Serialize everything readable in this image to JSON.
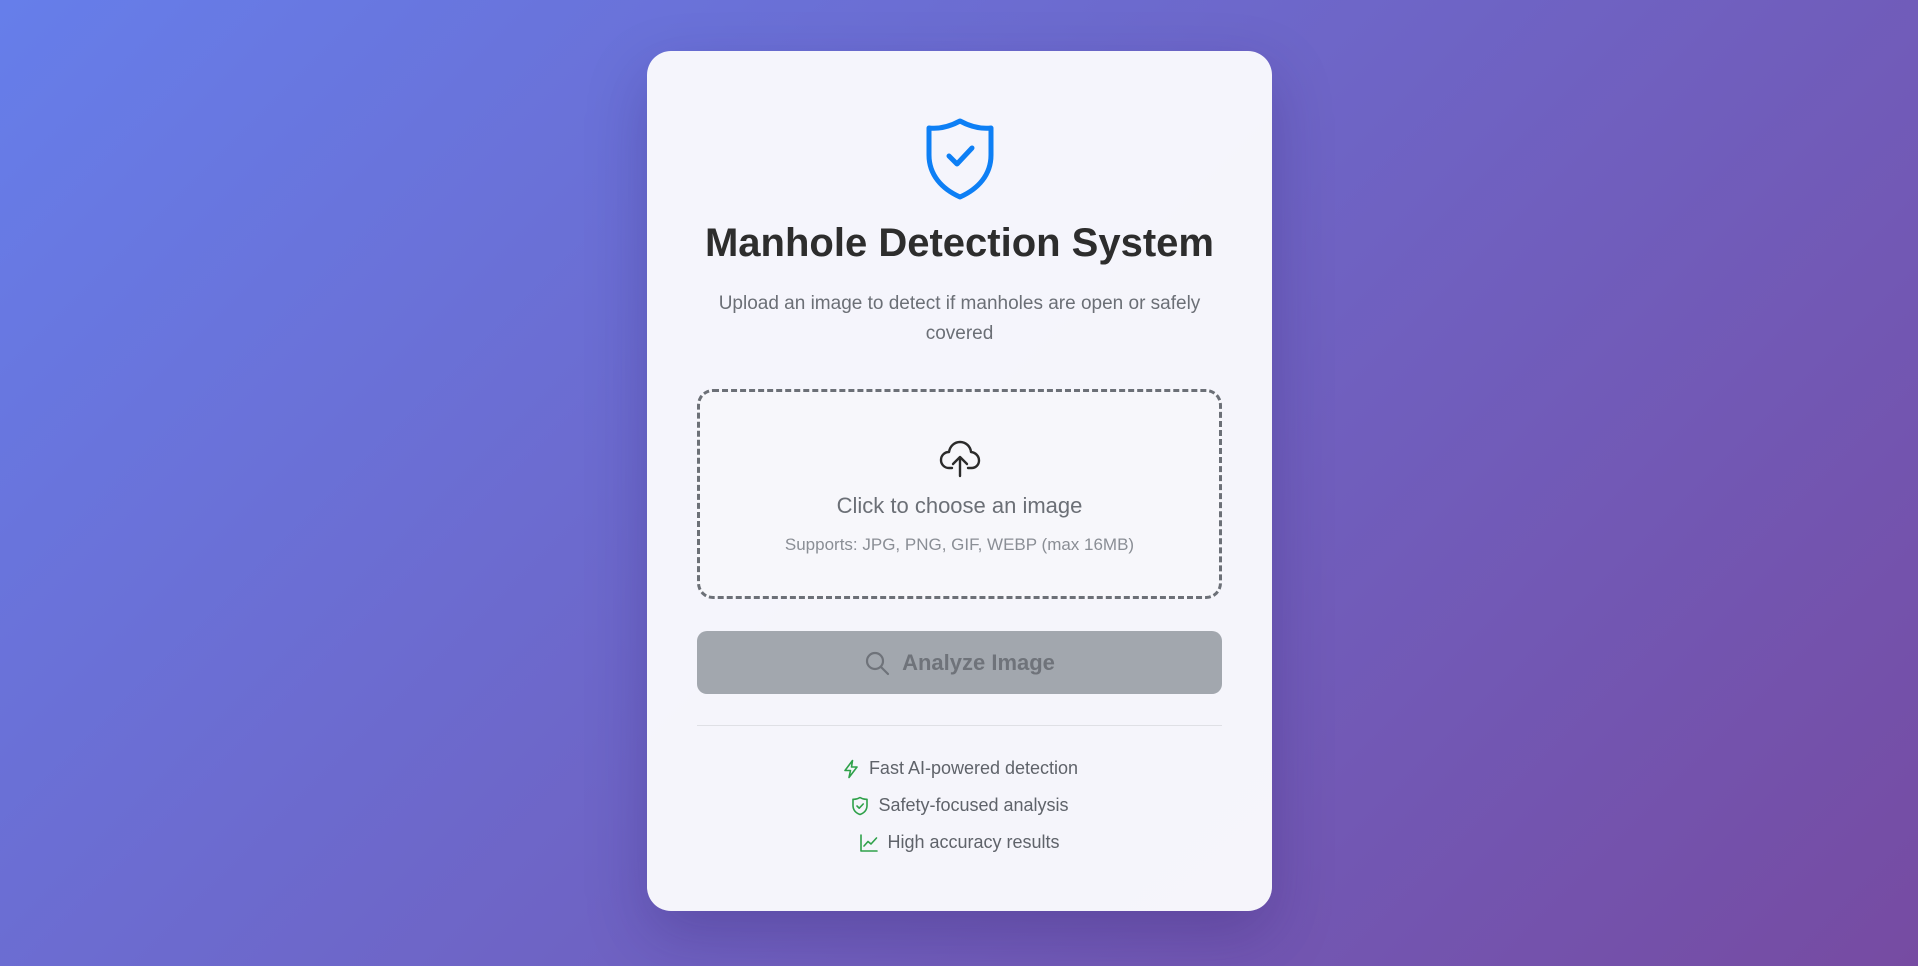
{
  "header": {
    "logo_icon": "shield-check-icon",
    "title": "Manhole Detection System",
    "subtitle": "Upload an image to detect if manholes are open or safely covered"
  },
  "upload": {
    "icon": "cloud-upload-icon",
    "label": "Click to choose an image",
    "hint": "Supports: JPG, PNG, GIF, WEBP (max 16MB)"
  },
  "analyze_button": {
    "icon": "search-icon",
    "label": "Analyze Image",
    "enabled": false
  },
  "features": [
    {
      "icon": "lightning-icon",
      "label": "Fast AI-powered detection"
    },
    {
      "icon": "shield-check-icon",
      "label": "Safety-focused analysis"
    },
    {
      "icon": "line-chart-icon",
      "label": "High accuracy results"
    }
  ],
  "colors": {
    "background_start": "#667eea",
    "background_end": "#764ba2",
    "accent_blue": "#0d7ff5",
    "feature_green": "#2fa14a",
    "button_disabled": "#a2a7ae"
  }
}
